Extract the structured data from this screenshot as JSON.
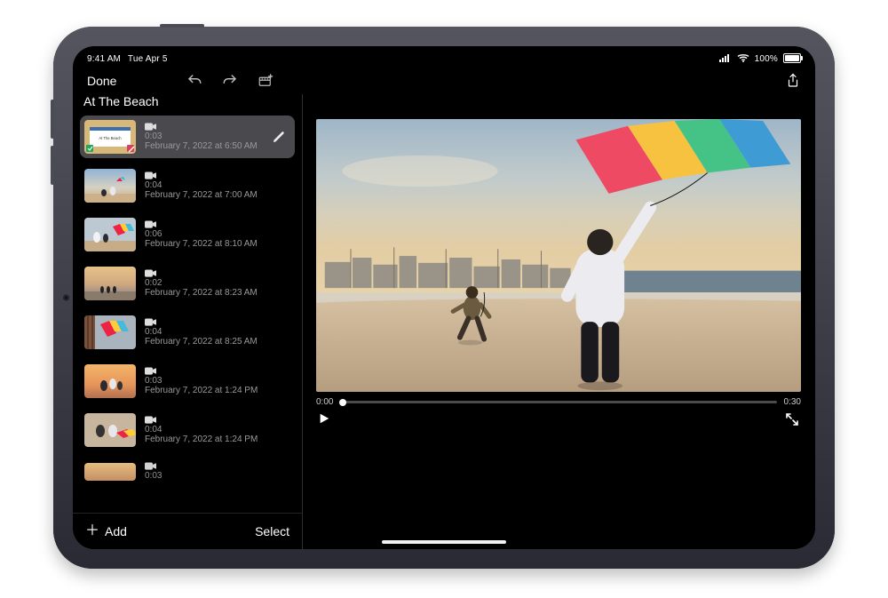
{
  "status": {
    "time": "9:41 AM",
    "date": "Tue Apr 5",
    "battery_pct": "100%"
  },
  "toolbar": {
    "done_label": "Done"
  },
  "project": {
    "title": "At The Beach"
  },
  "clips": [
    {
      "duration": "0:03",
      "date": "February 7, 2022 at 6:50 AM",
      "selected": true,
      "title_card": true
    },
    {
      "duration": "0:04",
      "date": "February 7, 2022 at 7:00 AM",
      "selected": false,
      "title_card": false
    },
    {
      "duration": "0:06",
      "date": "February 7, 2022 at 8:10 AM",
      "selected": false,
      "title_card": false
    },
    {
      "duration": "0:02",
      "date": "February 7, 2022 at 8:23 AM",
      "selected": false,
      "title_card": false
    },
    {
      "duration": "0:04",
      "date": "February 7, 2022 at 8:25 AM",
      "selected": false,
      "title_card": false
    },
    {
      "duration": "0:03",
      "date": "February 7, 2022 at 1:24 PM",
      "selected": false,
      "title_card": false
    },
    {
      "duration": "0:04",
      "date": "February 7, 2022 at 1:24 PM",
      "selected": false,
      "title_card": false
    },
    {
      "duration": "0:03",
      "date": "",
      "selected": false,
      "title_card": false
    }
  ],
  "footer": {
    "add_label": "Add",
    "select_label": "Select"
  },
  "preview": {
    "current_time": "0:00",
    "total_time": "0:30"
  }
}
